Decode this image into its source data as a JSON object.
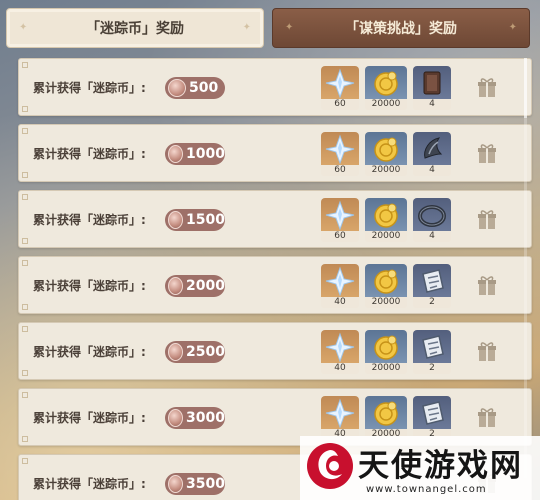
{
  "tabs": [
    {
      "label": "「迷踪币」奖励",
      "active": true
    },
    {
      "label": "「谋策挑战」奖励",
      "active": false
    }
  ],
  "reward_rows": [
    {
      "label": "累计获得「迷踪币」:",
      "threshold": "500",
      "items": [
        {
          "icon": "primogem-icon",
          "qty": "60",
          "rarity": "orange"
        },
        {
          "icon": "mora-icon",
          "qty": "20000",
          "rarity": "blue"
        },
        {
          "icon": "talent-book-icon",
          "qty": "4",
          "rarity": "purple"
        }
      ]
    },
    {
      "label": "累计获得「迷踪币」:",
      "threshold": "1000",
      "items": [
        {
          "icon": "primogem-icon",
          "qty": "60",
          "rarity": "orange"
        },
        {
          "icon": "mora-icon",
          "qty": "20000",
          "rarity": "blue"
        },
        {
          "icon": "weapon-material-icon",
          "qty": "4",
          "rarity": "purple"
        }
      ]
    },
    {
      "label": "累计获得「迷踪币」:",
      "threshold": "1500",
      "items": [
        {
          "icon": "primogem-icon",
          "qty": "60",
          "rarity": "orange"
        },
        {
          "icon": "mora-icon",
          "qty": "20000",
          "rarity": "blue"
        },
        {
          "icon": "ring-material-icon",
          "qty": "4",
          "rarity": "purple"
        }
      ]
    },
    {
      "label": "累计获得「迷踪币」:",
      "threshold": "2000",
      "items": [
        {
          "icon": "primogem-icon",
          "qty": "40",
          "rarity": "orange"
        },
        {
          "icon": "mora-icon",
          "qty": "20000",
          "rarity": "blue"
        },
        {
          "icon": "mystic-ore-icon",
          "qty": "2",
          "rarity": "purple"
        }
      ]
    },
    {
      "label": "累计获得「迷踪币」:",
      "threshold": "2500",
      "items": [
        {
          "icon": "primogem-icon",
          "qty": "40",
          "rarity": "orange"
        },
        {
          "icon": "mora-icon",
          "qty": "20000",
          "rarity": "blue"
        },
        {
          "icon": "mystic-ore-icon",
          "qty": "2",
          "rarity": "purple"
        }
      ]
    },
    {
      "label": "累计获得「迷踪币」:",
      "threshold": "3000",
      "items": [
        {
          "icon": "primogem-icon",
          "qty": "40",
          "rarity": "orange"
        },
        {
          "icon": "mora-icon",
          "qty": "20000",
          "rarity": "blue"
        },
        {
          "icon": "mystic-ore-icon",
          "qty": "2",
          "rarity": "purple"
        }
      ]
    },
    {
      "label": "累计获得「迷踪币」:",
      "threshold": "3500",
      "items": []
    }
  ],
  "watermark": {
    "name": "天使游戏网",
    "url": "www.townangel.com"
  },
  "colors": {
    "tab_active_bg": "#efe6d6",
    "tab_inactive_bg": "#7a5240",
    "pill_bg": "#9e7068",
    "row_bg": "#efe9dd"
  }
}
